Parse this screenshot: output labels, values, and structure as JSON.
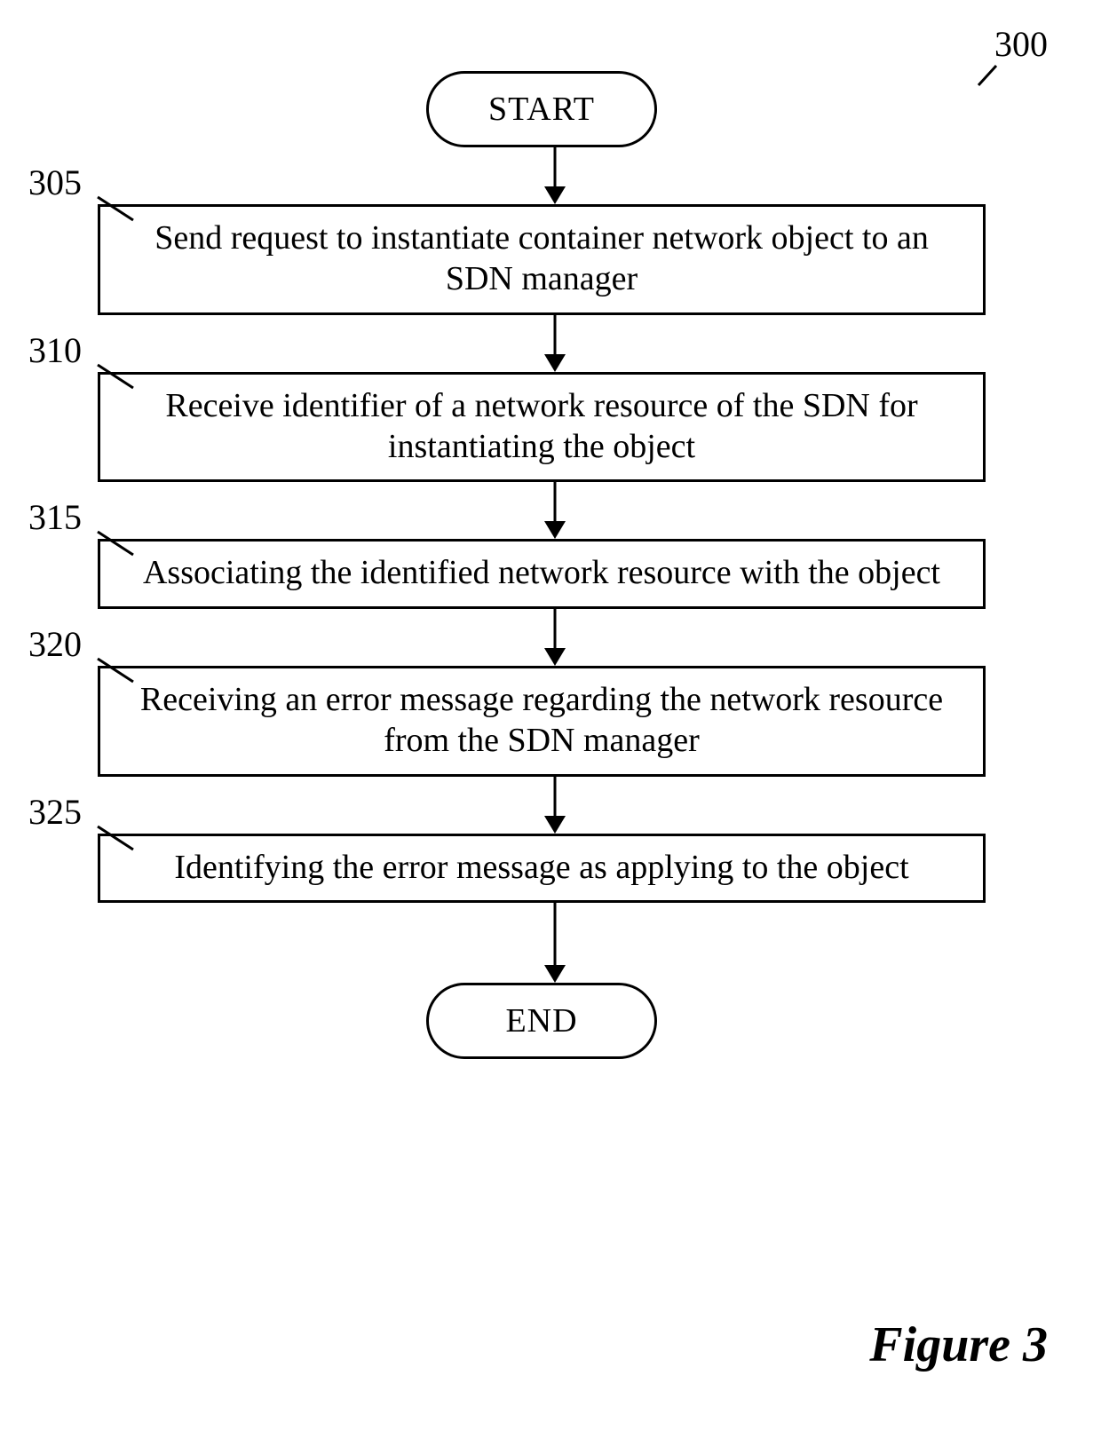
{
  "flowchart": {
    "ref_number": "300",
    "start_label": "START",
    "end_label": "END",
    "caption": "Figure 3",
    "steps": [
      {
        "ref": "305",
        "text": "Send request to instantiate container network object to an SDN manager"
      },
      {
        "ref": "310",
        "text": "Receive identifier of a network resource of the SDN for instantiating the object"
      },
      {
        "ref": "315",
        "text": "Associating the identified network resource with the object"
      },
      {
        "ref": "320",
        "text": "Receiving an error message regarding the network resource from the SDN manager"
      },
      {
        "ref": "325",
        "text": "Identifying the error message as applying to the object"
      }
    ]
  }
}
